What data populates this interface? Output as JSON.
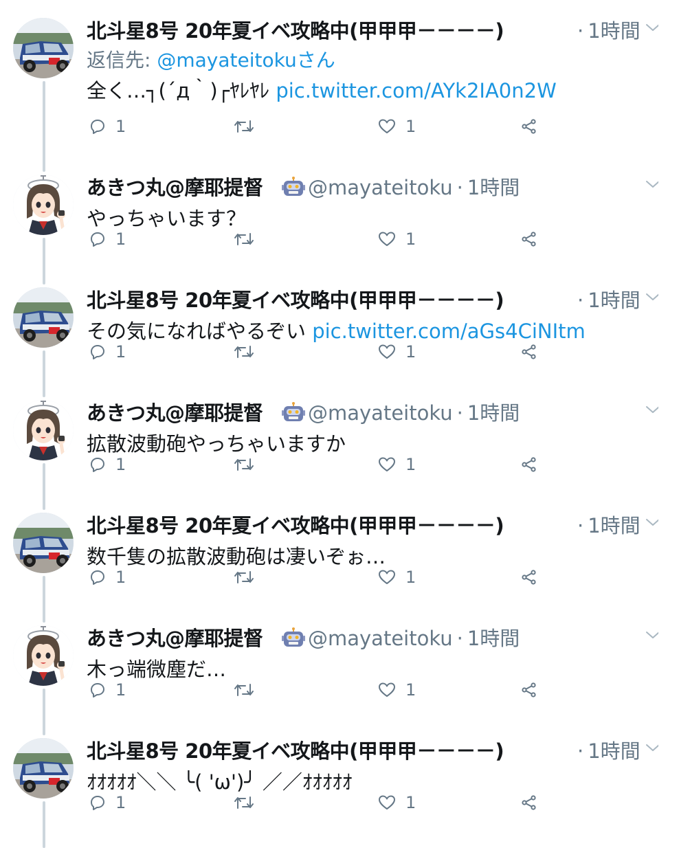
{
  "tweets": [
    {
      "author": "hokuto",
      "name": "北斗星8号 20年夏イベ攻略中(甲甲甲－－－－)",
      "handle": "",
      "time": "1時間",
      "reply_to_prefix": "返信先: ",
      "reply_to_mention": "@mayateitokuさん",
      "text": "全く…┐(´д｀)┌ﾔﾚﾔﾚ ",
      "link": "pic.twitter.com/AYk2IA0n2W",
      "replies": "1",
      "retweets": "",
      "likes": "1"
    },
    {
      "author": "akitsu",
      "name": "あきつ丸@摩耶提督",
      "handle": "@mayateitoku",
      "time": "1時間",
      "text": "やっちゃいます？",
      "link": "",
      "replies": "1",
      "retweets": "",
      "likes": "1"
    },
    {
      "author": "hokuto",
      "name": "北斗星8号 20年夏イベ攻略中(甲甲甲－－－－)",
      "handle": "",
      "time": "1時間",
      "text": "その気になればやるぞい ",
      "link": "pic.twitter.com/aGs4CiNItm",
      "replies": "1",
      "retweets": "",
      "likes": "1"
    },
    {
      "author": "akitsu",
      "name": "あきつ丸@摩耶提督",
      "handle": "@mayateitoku",
      "time": "1時間",
      "text": "拡散波動砲やっちゃいますか",
      "link": "",
      "replies": "1",
      "retweets": "",
      "likes": "1"
    },
    {
      "author": "hokuto",
      "name": "北斗星8号 20年夏イベ攻略中(甲甲甲－－－－)",
      "handle": "",
      "time": "1時間",
      "text": "数千隻の拡散波動砲は凄いぞぉ…",
      "link": "",
      "replies": "1",
      "retweets": "",
      "likes": "1"
    },
    {
      "author": "akitsu",
      "name": "あきつ丸@摩耶提督",
      "handle": "@mayateitoku",
      "time": "1時間",
      "text": "木っ端微塵だ…",
      "link": "",
      "replies": "1",
      "retweets": "",
      "likes": "1"
    },
    {
      "author": "hokuto",
      "name": "北斗星8号 20年夏イベ攻略中(甲甲甲－－－－)",
      "handle": "",
      "time": "1時間",
      "text": "ｵｵｵｵｵ＼＼ ╰( 'ω')╯ ／／ｵｵｵｵｵ",
      "link": "",
      "replies": "1",
      "retweets": "",
      "likes": "1"
    }
  ],
  "dot_separator": "·",
  "icons": {
    "reply": "reply-icon",
    "retweet": "retweet-icon",
    "like": "heart-icon",
    "share": "share-icon",
    "menu": "chevron-down-icon",
    "bot": "robot-emoji-icon"
  },
  "colors": {
    "link": "#1b95e0",
    "muted": "#657786",
    "thread": "#ccd6dd"
  }
}
